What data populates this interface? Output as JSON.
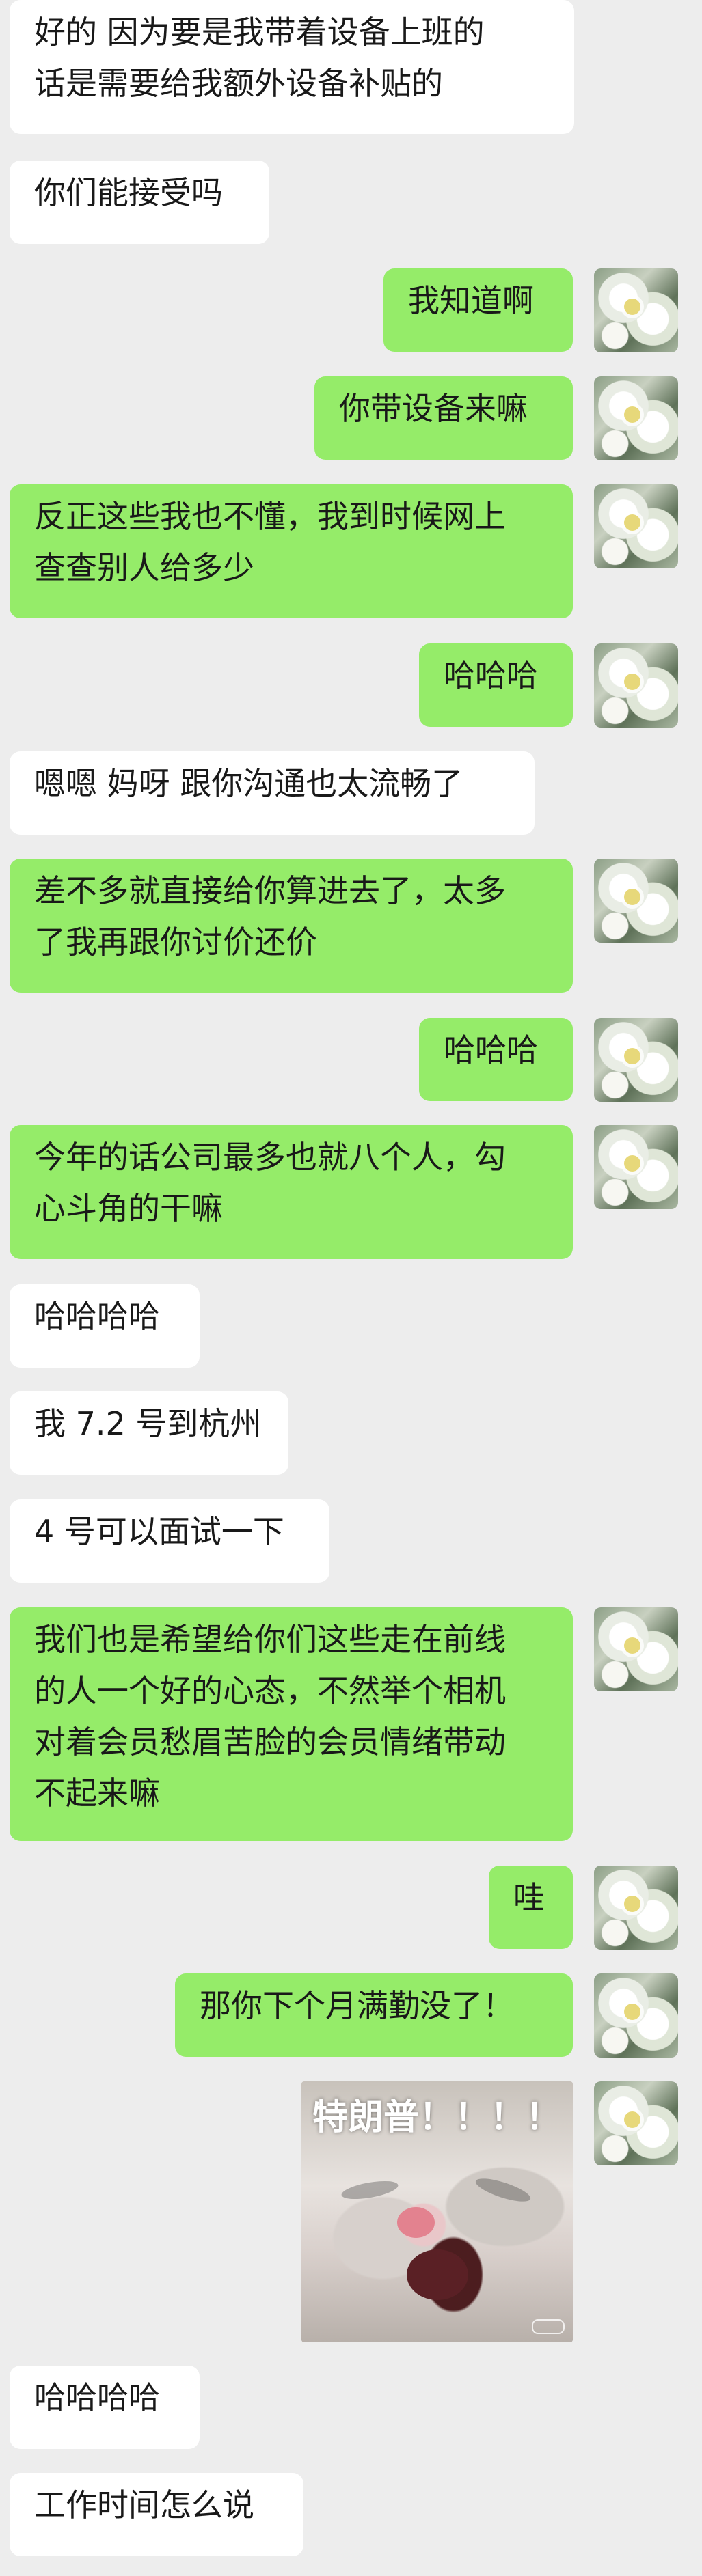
{
  "messages": [
    {
      "side": "in",
      "text": "好的 因为要是我带着设备上班的\n话是需要给我额外设备补贴的"
    },
    {
      "side": "in",
      "text": "你们能接受吗"
    },
    {
      "side": "out",
      "text": "我知道啊"
    },
    {
      "side": "out",
      "text": "你带设备来嘛"
    },
    {
      "side": "out",
      "text": "反正这些我也不懂，我到时候网上\n查查别人给多少"
    },
    {
      "side": "out",
      "text": "哈哈哈"
    },
    {
      "side": "in",
      "text": "嗯嗯 妈呀 跟你沟通也太流畅了"
    },
    {
      "side": "out",
      "text": "差不多就直接给你算进去了，太多\n了我再跟你讨价还价"
    },
    {
      "side": "out",
      "text": "哈哈哈"
    },
    {
      "side": "out",
      "text": "今年的话公司最多也就八个人，勾\n心斗角的干嘛"
    },
    {
      "side": "in",
      "text": "哈哈哈哈"
    },
    {
      "side": "in",
      "text": "我 7.2 号到杭州"
    },
    {
      "side": "in",
      "text": "4 号可以面试一下"
    },
    {
      "side": "out",
      "text": "我们也是希望给你们这些走在前线\n的人一个好的心态，不然举个相机\n对着会员愁眉苦脸的会员情绪带动\n不起来嘛"
    },
    {
      "side": "out",
      "text": "哇"
    },
    {
      "side": "out",
      "text": "那你下个月满勤没了！"
    },
    {
      "side": "out",
      "type": "sticker",
      "caption": "特朗普！！！！"
    },
    {
      "side": "in",
      "text": "哈哈哈哈"
    },
    {
      "side": "in",
      "text": "工作时间怎么说"
    }
  ]
}
